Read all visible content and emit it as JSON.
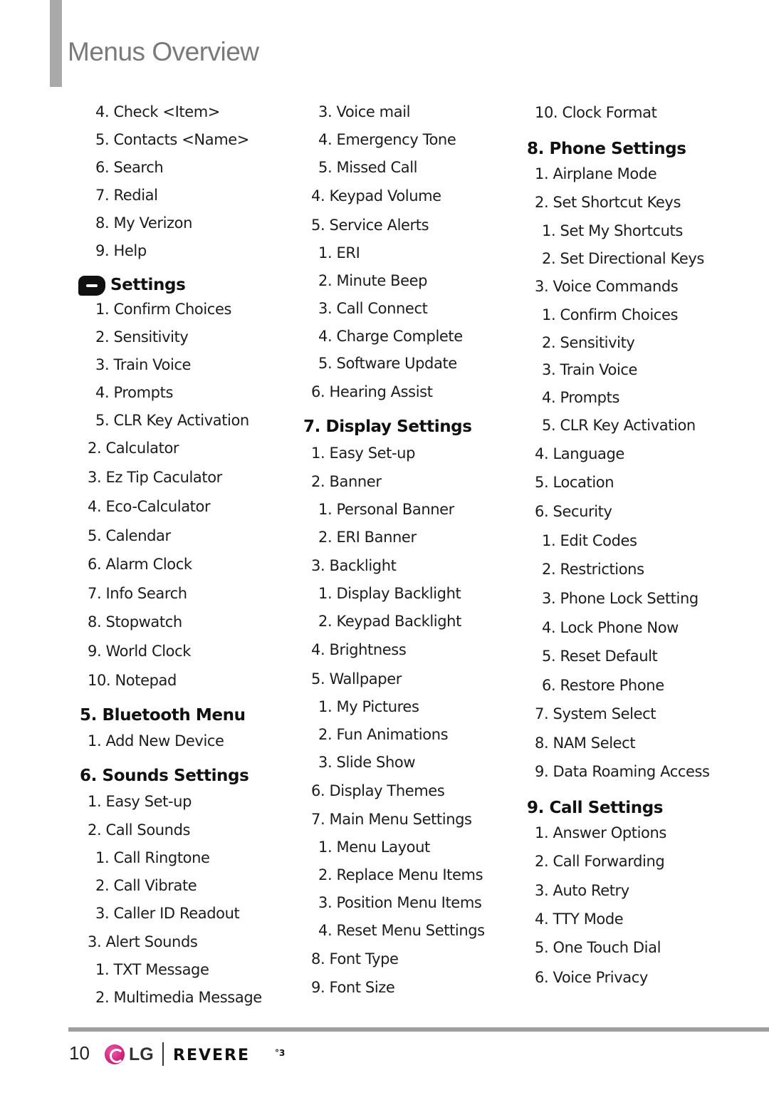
{
  "header": {
    "title": "Menus Overview"
  },
  "footer": {
    "page_number": "10",
    "logo_text": "LG",
    "brand": "REVERE",
    "brand_suffix": "°3"
  },
  "columns": [
    {
      "entries": [
        {
          "type": "item",
          "level": 2,
          "text": "4. Check <Item>"
        },
        {
          "type": "item",
          "level": 2,
          "text": "5. Contacts <Name>"
        },
        {
          "type": "item",
          "level": 2,
          "text": "6. Search"
        },
        {
          "type": "item",
          "level": 2,
          "text": "7. Redial"
        },
        {
          "type": "item",
          "level": 2,
          "text": "8. My Verizon"
        },
        {
          "type": "item",
          "level": 2,
          "text": "9. Help"
        },
        {
          "type": "head",
          "icon": "settings-icon",
          "text": "Settings"
        },
        {
          "type": "item",
          "level": 2,
          "text": "1. Confirm Choices"
        },
        {
          "type": "item",
          "level": 2,
          "text": "2. Sensitivity"
        },
        {
          "type": "item",
          "level": 2,
          "text": "3. Train Voice"
        },
        {
          "type": "item",
          "level": 2,
          "text": "4. Prompts"
        },
        {
          "type": "item",
          "level": 2,
          "text": "5. CLR Key Activation"
        },
        {
          "type": "item",
          "level": 1,
          "text": "2. Calculator"
        },
        {
          "type": "item",
          "level": 1,
          "text": "3. Ez Tip Caculator"
        },
        {
          "type": "item",
          "level": 1,
          "text": "4. Eco-Calculator"
        },
        {
          "type": "item",
          "level": 1,
          "text": "5. Calendar"
        },
        {
          "type": "item",
          "level": 1,
          "text": "6. Alarm Clock"
        },
        {
          "type": "item",
          "level": 1,
          "text": "7. Info Search"
        },
        {
          "type": "item",
          "level": 1,
          "text": "8. Stopwatch"
        },
        {
          "type": "item",
          "level": 1,
          "text": "9. World Clock"
        },
        {
          "type": "item",
          "level": 1,
          "text": "10. Notepad"
        },
        {
          "type": "head",
          "text": "5. Bluetooth Menu"
        },
        {
          "type": "item",
          "level": 1,
          "text": "1. Add New Device"
        },
        {
          "type": "head",
          "text": "6. Sounds Settings"
        },
        {
          "type": "item",
          "level": 1,
          "text": "1. Easy Set-up"
        },
        {
          "type": "item",
          "level": 1,
          "text": "2. Call Sounds"
        },
        {
          "type": "item",
          "level": 2,
          "text": "1. Call Ringtone"
        },
        {
          "type": "item",
          "level": 2,
          "text": "2. Call Vibrate"
        },
        {
          "type": "item",
          "level": 2,
          "text": "3. Caller ID Readout"
        },
        {
          "type": "item",
          "level": 1,
          "text": "3. Alert Sounds"
        },
        {
          "type": "item",
          "level": 2,
          "text": "1. TXT Message"
        },
        {
          "type": "item",
          "level": 2,
          "text": "2. Multimedia Message"
        }
      ]
    },
    {
      "entries": [
        {
          "type": "item",
          "level": 2,
          "text": "3. Voice mail"
        },
        {
          "type": "item",
          "level": 2,
          "text": "4. Emergency Tone"
        },
        {
          "type": "item",
          "level": 2,
          "text": "5. Missed Call"
        },
        {
          "type": "item",
          "level": 1,
          "text": "4. Keypad Volume"
        },
        {
          "type": "item",
          "level": 1,
          "text": "5. Service Alerts"
        },
        {
          "type": "item",
          "level": 2,
          "text": "1. ERI"
        },
        {
          "type": "item",
          "level": 2,
          "text": "2. Minute Beep"
        },
        {
          "type": "item",
          "level": 2,
          "text": "3. Call Connect"
        },
        {
          "type": "item",
          "level": 2,
          "text": "4. Charge Complete"
        },
        {
          "type": "item",
          "level": 2,
          "text": "5. Software Update"
        },
        {
          "type": "item",
          "level": 1,
          "text": "6. Hearing Assist"
        },
        {
          "type": "head",
          "text": "7. Display Settings"
        },
        {
          "type": "item",
          "level": 1,
          "text": "1. Easy Set-up"
        },
        {
          "type": "item",
          "level": 1,
          "text": "2. Banner"
        },
        {
          "type": "item",
          "level": 2,
          "text": "1. Personal Banner"
        },
        {
          "type": "item",
          "level": 2,
          "text": "2. ERI Banner"
        },
        {
          "type": "item",
          "level": 1,
          "text": "3. Backlight"
        },
        {
          "type": "item",
          "level": 2,
          "text": "1. Display Backlight"
        },
        {
          "type": "item",
          "level": 2,
          "text": "2. Keypad Backlight"
        },
        {
          "type": "item",
          "level": 1,
          "text": "4. Brightness"
        },
        {
          "type": "item",
          "level": 1,
          "text": "5. Wallpaper"
        },
        {
          "type": "item",
          "level": 2,
          "text": "1. My Pictures"
        },
        {
          "type": "item",
          "level": 2,
          "text": "2. Fun Animations"
        },
        {
          "type": "item",
          "level": 2,
          "text": "3. Slide Show"
        },
        {
          "type": "item",
          "level": 1,
          "text": "6. Display Themes"
        },
        {
          "type": "item",
          "level": 1,
          "text": "7. Main Menu Settings"
        },
        {
          "type": "item",
          "level": 2,
          "text": "1. Menu Layout"
        },
        {
          "type": "item",
          "level": 2,
          "text": "2. Replace Menu Items"
        },
        {
          "type": "item",
          "level": 2,
          "text": "3. Position Menu Items"
        },
        {
          "type": "item",
          "level": 2,
          "text": "4. Reset Menu Settings"
        },
        {
          "type": "item",
          "level": 1,
          "text": "8. Font Type"
        },
        {
          "type": "item",
          "level": 1,
          "text": "9. Font Size"
        }
      ]
    },
    {
      "entries": [
        {
          "type": "item",
          "level": 1,
          "text": "10. Clock Format"
        },
        {
          "type": "head",
          "text": "8. Phone Settings"
        },
        {
          "type": "item",
          "level": 1,
          "text": "1. Airplane Mode"
        },
        {
          "type": "item",
          "level": 1,
          "text": "2. Set Shortcut Keys"
        },
        {
          "type": "item",
          "level": 2,
          "text": "1. Set My Shortcuts"
        },
        {
          "type": "item",
          "level": 2,
          "text": "2. Set Directional Keys"
        },
        {
          "type": "item",
          "level": 1,
          "text": "3. Voice Commands"
        },
        {
          "type": "item",
          "level": 2,
          "text": "1. Confirm Choices"
        },
        {
          "type": "item",
          "level": 2,
          "text": "2. Sensitivity"
        },
        {
          "type": "item",
          "level": 2,
          "text": "3. Train Voice"
        },
        {
          "type": "item",
          "level": 2,
          "text": "4. Prompts"
        },
        {
          "type": "item",
          "level": 2,
          "text": "5. CLR Key Activation"
        },
        {
          "type": "item",
          "level": 1,
          "text": "4. Language"
        },
        {
          "type": "item",
          "level": 1,
          "text": "5. Location"
        },
        {
          "type": "item",
          "level": 1,
          "text": "6. Security"
        },
        {
          "type": "item",
          "level": 2,
          "text": "1. Edit Codes"
        },
        {
          "type": "item",
          "level": 2,
          "text": "2. Restrictions"
        },
        {
          "type": "item",
          "level": 2,
          "text": "3. Phone Lock Setting"
        },
        {
          "type": "item",
          "level": 2,
          "text": "4. Lock Phone Now"
        },
        {
          "type": "item",
          "level": 2,
          "text": "5. Reset Default"
        },
        {
          "type": "item",
          "level": 2,
          "text": "6. Restore Phone"
        },
        {
          "type": "item",
          "level": 1,
          "text": "7. System Select"
        },
        {
          "type": "item",
          "level": 1,
          "text": "8. NAM Select"
        },
        {
          "type": "item",
          "level": 1,
          "text": "9. Data Roaming Access"
        },
        {
          "type": "head",
          "text": "9. Call Settings"
        },
        {
          "type": "item",
          "level": 1,
          "text": "1. Answer Options"
        },
        {
          "type": "item",
          "level": 1,
          "text": "2. Call Forwarding"
        },
        {
          "type": "item",
          "level": 1,
          "text": "3. Auto Retry"
        },
        {
          "type": "item",
          "level": 1,
          "text": "4. TTY Mode"
        },
        {
          "type": "item",
          "level": 1,
          "text": "5. One Touch Dial"
        },
        {
          "type": "item",
          "level": 1,
          "text": "6. Voice Privacy"
        }
      ]
    }
  ]
}
